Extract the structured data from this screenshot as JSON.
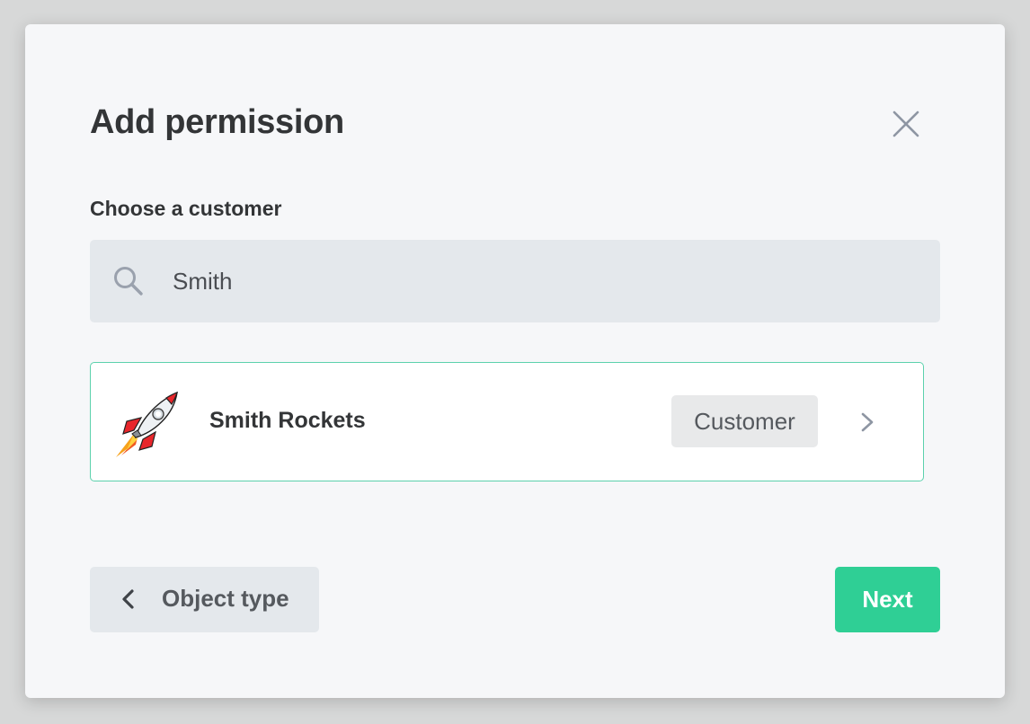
{
  "dialog": {
    "title": "Add permission"
  },
  "customer_picker": {
    "label": "Choose a customer",
    "search": {
      "value": "Smith",
      "icon": "search-icon"
    },
    "results": [
      {
        "name": "Smith Rockets",
        "badge": "Customer",
        "avatar_icon": "rocket-icon"
      }
    ]
  },
  "footer": {
    "back_label": "Object type",
    "next_label": "Next"
  },
  "colors": {
    "accent": "#2fcf95",
    "selected_border": "#5cd1ad",
    "backdrop": "#d7d8d8",
    "panel": "#f6f7f9"
  }
}
